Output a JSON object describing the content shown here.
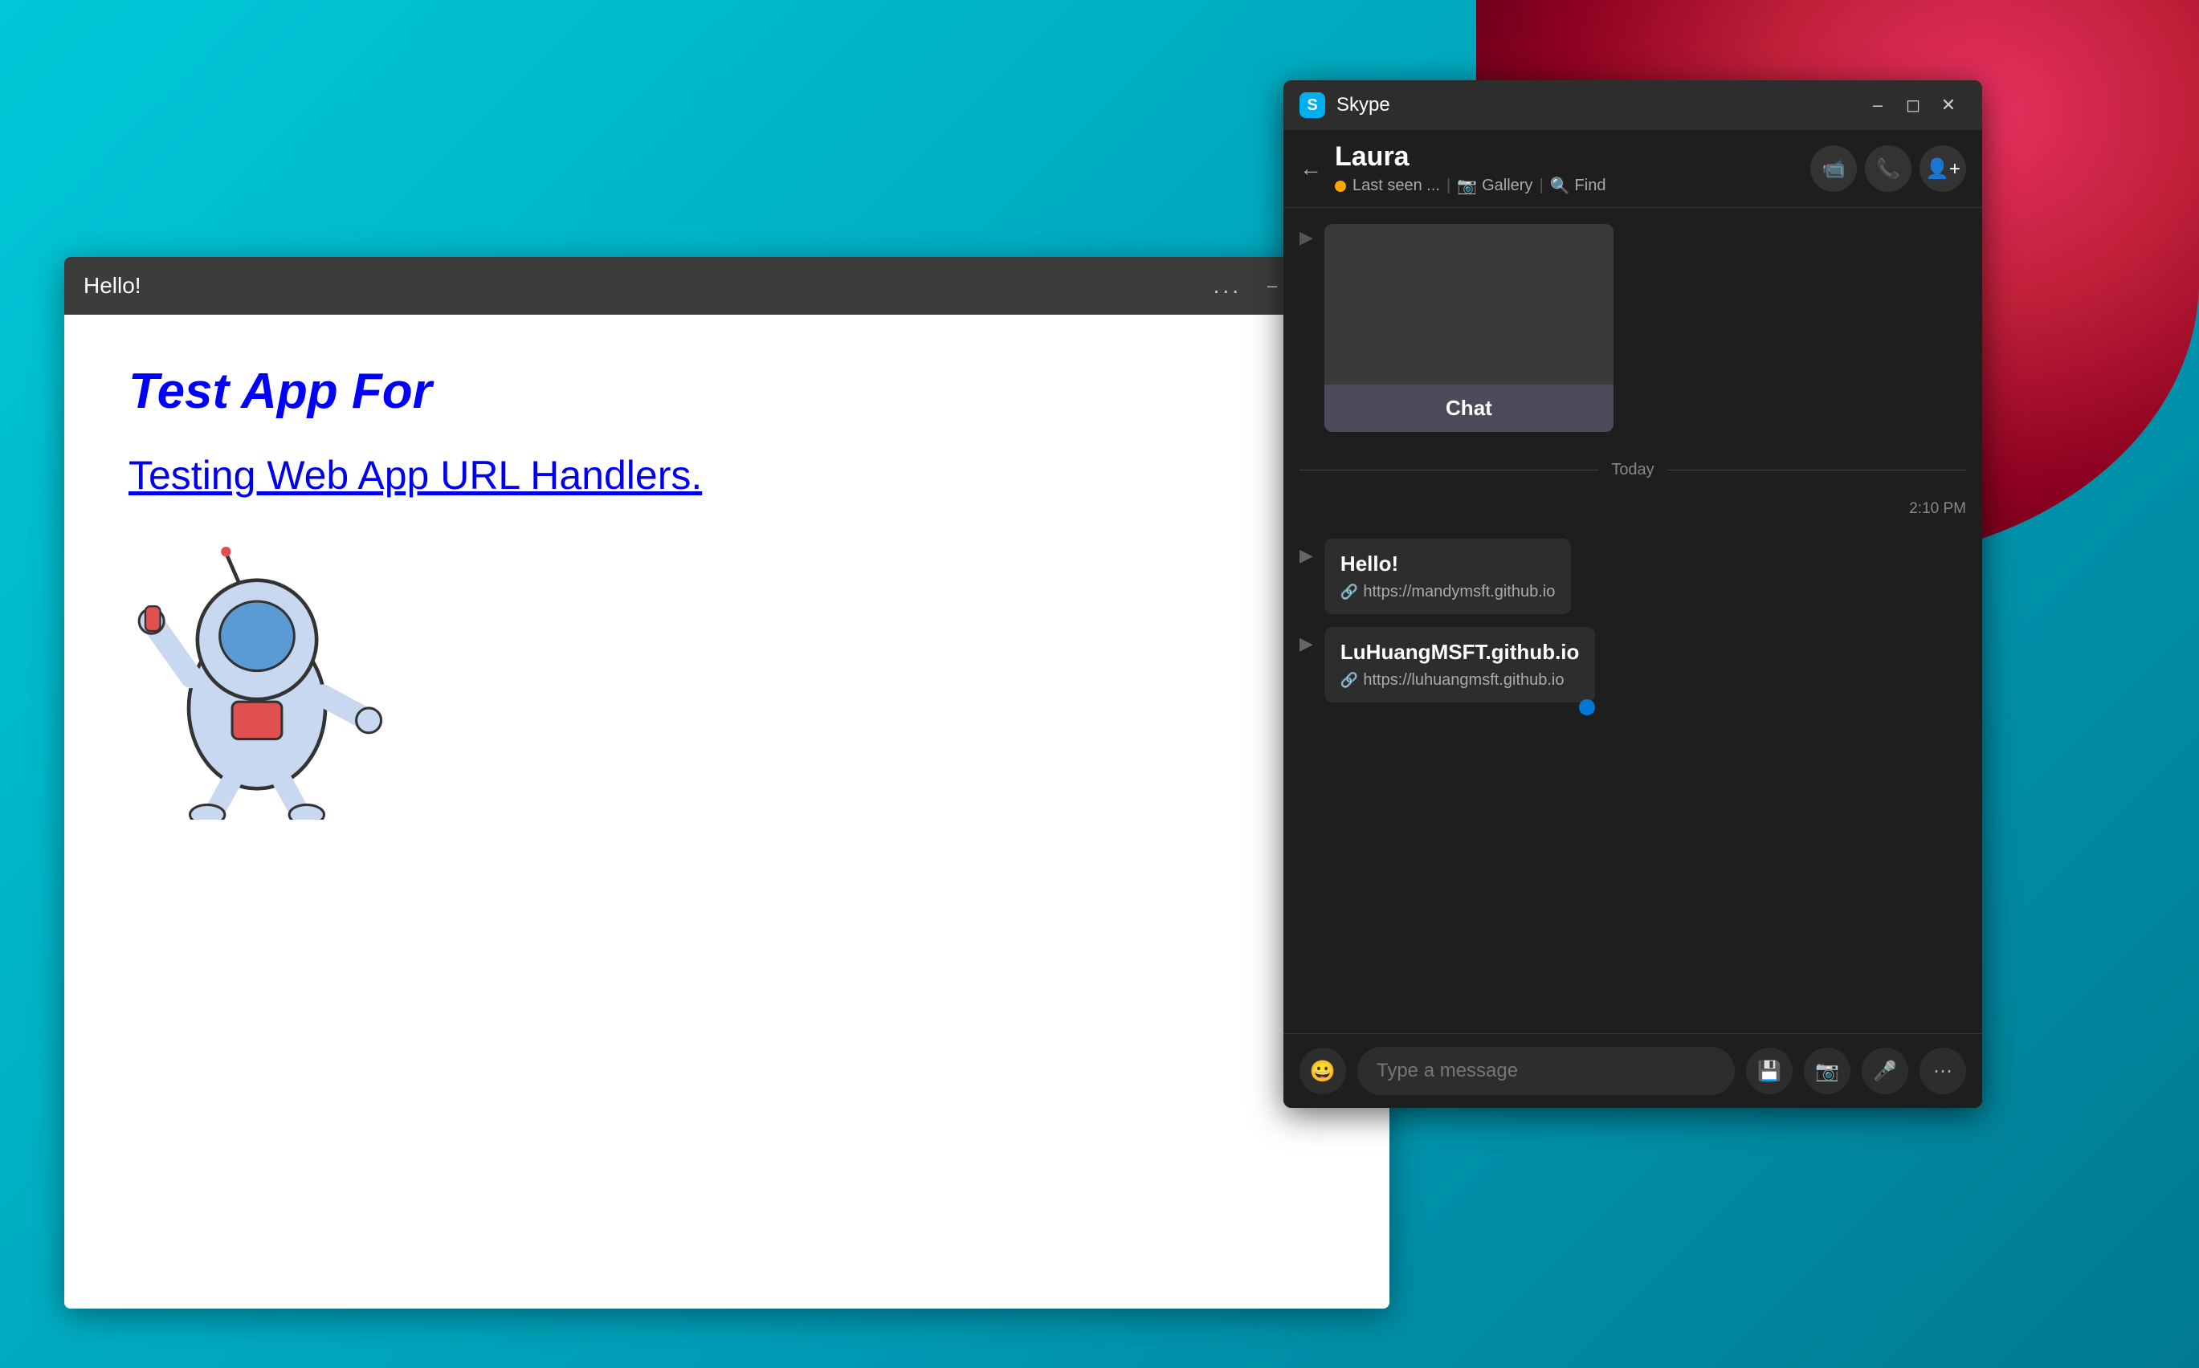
{
  "desktop": {
    "background_color": "#00b5c8"
  },
  "webapp_window": {
    "title": "Hello!",
    "heading": "Test App For",
    "link_text": "Testing Web App URL Handlers",
    "link_period": ".",
    "minimize_label": "minimize",
    "maximize_label": "maximize",
    "close_label": "close",
    "dots": "..."
  },
  "skype_window": {
    "title": "Skype",
    "contact_name": "Laura",
    "status_text": "Last seen ...",
    "gallery_label": "Gallery",
    "find_label": "Find",
    "preview_label": "Chat",
    "day_divider": "Today",
    "timestamp": "2:10 PM",
    "message1_text": "Hello!",
    "message1_link": "https://mandymsft.github.io",
    "message2_text": "LuHuangMSFT.github.io",
    "message2_link": "https://luhuangmsft.github.io",
    "input_placeholder": "Type a message",
    "minimize_label": "minimize",
    "maximize_label": "maximize",
    "close_label": "close"
  }
}
